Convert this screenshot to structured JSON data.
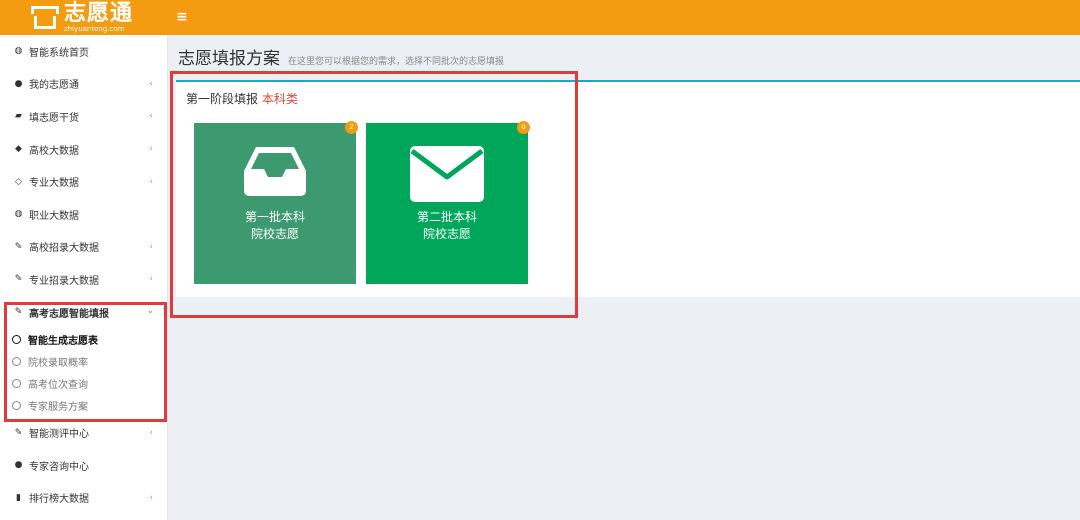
{
  "brand": {
    "title": "志愿通",
    "subtitle": "zhiyuantong.com"
  },
  "topbar": {
    "menu_icon": "≡"
  },
  "sidebar": {
    "items": [
      {
        "label": "智能系统首页",
        "icon": "dashboard-icon",
        "glyph": "◍",
        "chevron": ""
      },
      {
        "label": "我的志愿通",
        "icon": "user-icon",
        "glyph": "●",
        "chevron": "‹"
      },
      {
        "label": "填志愿干货",
        "icon": "book-icon",
        "glyph": "▰",
        "chevron": "‹"
      },
      {
        "label": "高校大数据",
        "icon": "graduation-cap-icon",
        "glyph": "◆",
        "chevron": "‹"
      },
      {
        "label": "专业大数据",
        "icon": "diamond-icon",
        "glyph": "◇",
        "chevron": "‹"
      },
      {
        "label": "职业大数据",
        "icon": "dashboard-icon",
        "glyph": "◍",
        "chevron": ""
      },
      {
        "label": "高校招录大数据",
        "icon": "edit-icon",
        "glyph": "✎",
        "chevron": "‹"
      },
      {
        "label": "专业招录大数据",
        "icon": "edit-icon",
        "glyph": "✎",
        "chevron": "‹"
      }
    ],
    "open_group": {
      "label": "高考志愿智能填报",
      "icon": "edit-icon",
      "glyph": "✎",
      "chevron": "‹",
      "children": [
        {
          "label": "智能生成志愿表",
          "active": true
        },
        {
          "label": "院校录取概率"
        },
        {
          "label": "高考位次查询"
        },
        {
          "label": "专家服务方案"
        }
      ]
    },
    "bottom_items": [
      {
        "label": "智能测评中心",
        "icon": "edit-icon",
        "glyph": "✎",
        "chevron": "‹"
      },
      {
        "label": "专家咨询中心",
        "icon": "comment-icon",
        "glyph": "●",
        "chevron": ""
      },
      {
        "label": "排行榜大数据",
        "icon": "bar-chart-icon",
        "glyph": "▮",
        "chevron": "‹"
      }
    ]
  },
  "header": {
    "title": "志愿填报方案",
    "description": "在这里您可以根据您的需求，选择不同批次的志愿填报"
  },
  "stage": {
    "title": "第一阶段填报",
    "category": "本科类",
    "tiles": [
      {
        "line1": "第一批本科",
        "line2": "院校志愿",
        "badge": "2",
        "icon": "inbox-icon",
        "color": "#3d9970"
      },
      {
        "line1": "第二批本科",
        "line2": "院校志愿",
        "badge": "0",
        "icon": "envelope-icon",
        "color": "#00a65a"
      }
    ]
  },
  "colors": {
    "topbar": "#f39c12",
    "panel_border": "#00b3d7",
    "highlight": "#e03a3e",
    "accent_text": "#dd4b39"
  }
}
